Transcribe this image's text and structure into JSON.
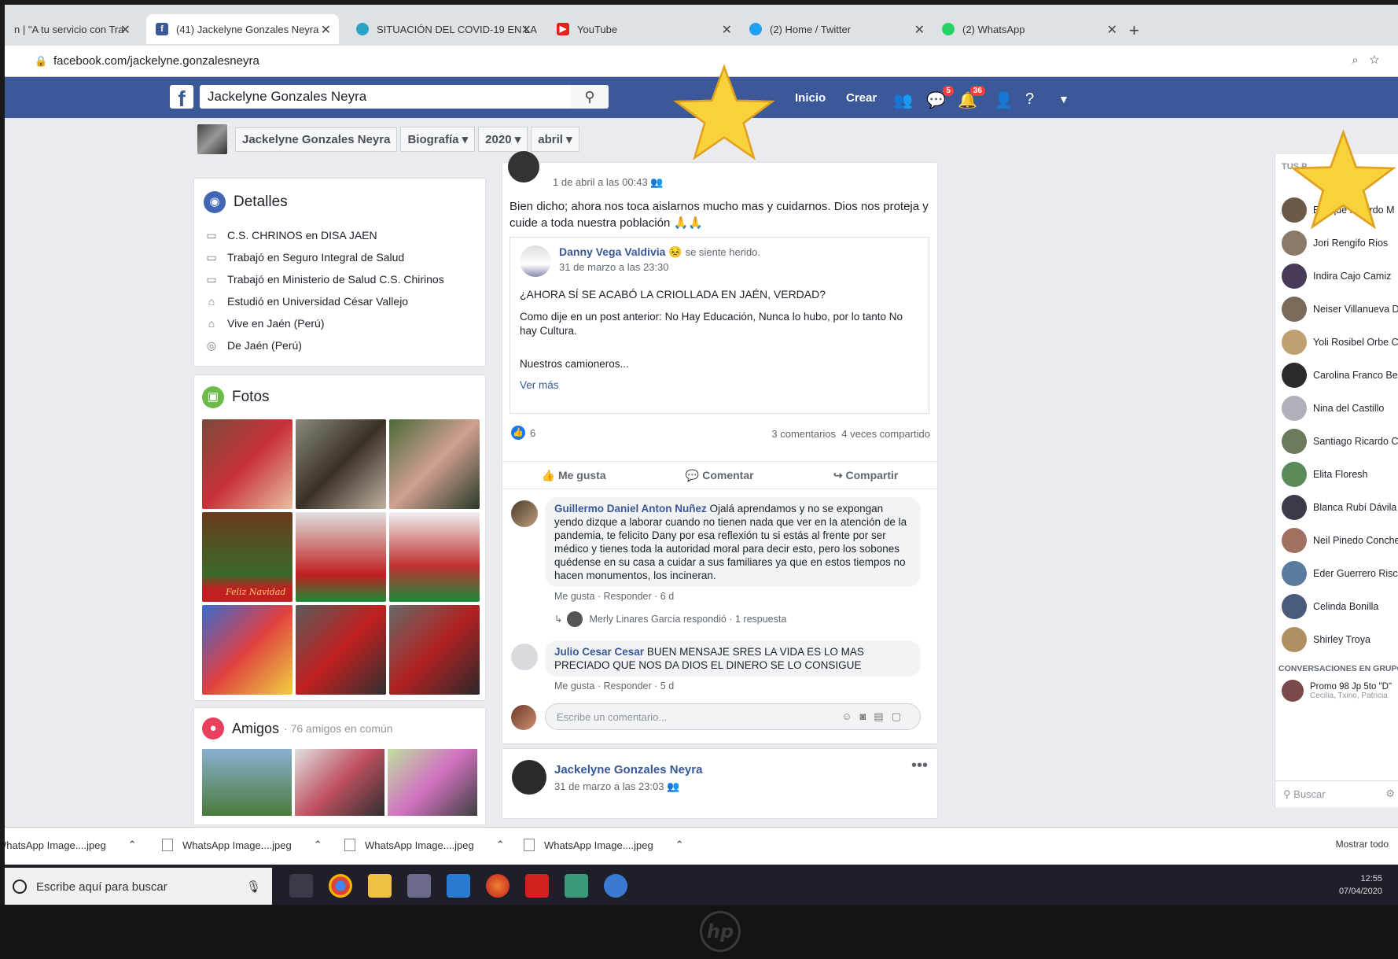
{
  "tabs": [
    {
      "title": "n | \"A tu servicio con Tra",
      "icon": "tab-doc-icon"
    },
    {
      "title": "(41) Jackelyne Gonzales Neyra",
      "icon": "facebook-icon"
    },
    {
      "title": "SITUACIÓN DEL COVID-19 EN LA",
      "icon": "globe-icon"
    },
    {
      "title": "YouTube",
      "icon": "youtube-icon"
    },
    {
      "title": "(2) Home / Twitter",
      "icon": "twitter-icon"
    },
    {
      "title": "(2) WhatsApp",
      "icon": "whatsapp-icon"
    }
  ],
  "url": "facebook.com/jackelyne.gonzalesneyra",
  "fb": {
    "search_value": "Jackelyne Gonzales Neyra",
    "nav": {
      "home": "Inicio",
      "create": "Crear",
      "messages_badge": "5",
      "notifications_badge": "36"
    }
  },
  "subnav": {
    "name": "Jackelyne Gonzales Neyra",
    "biography": "Biografía",
    "year": "2020",
    "month": "abril"
  },
  "details": {
    "title": "Detalles",
    "items": [
      "C.S. CHRINOS en DISA JAEN",
      "Trabajó en Seguro Integral de Salud",
      "Trabajó en Ministerio de Salud C.S. Chirinos",
      "Estudió en Universidad César Vallejo",
      "Vive en Jaén (Perú)",
      "De Jaén (Perú)"
    ]
  },
  "photos": {
    "title": "Fotos",
    "caption": "Feliz Navidad"
  },
  "friends": {
    "title": "Amigos",
    "subtitle": "· 76 amigos en común"
  },
  "post": {
    "timestamp": "1 de abril a las 00:43",
    "text": "Bien dicho; ahora nos toca aislarnos mucho mas y cuidarnos. Dios nos proteja y cuide a toda nuestra población 🙏🙏",
    "shared": {
      "author": "Danny Vega Valdivia",
      "feeling": "se siente herido.",
      "timestamp": "31 de marzo a las 23:30",
      "headline": "¿AHORA SÍ SE ACABÓ LA CRIOLLADA EN JAÉN, VERDAD?",
      "body": "Como dije en un post anterior: No Hay Educación, Nunca lo hubo, por lo tanto No hay Cultura.",
      "body2": "Nuestros camioneros...",
      "more": "Ver más"
    },
    "likes": "6",
    "comments_count": "3 comentarios",
    "shares_count": "4 veces compartido",
    "actions": {
      "like": "Me gusta",
      "comment": "Comentar",
      "share": "Compartir"
    }
  },
  "comments": [
    {
      "name": "Guillermo Daniel Anton Nuñez",
      "text": "Ojalá aprendamos y no se expongan yendo dizque a laborar cuando no tienen nada que ver en la atención de la pandemia, te felicito Dany por esa reflexión tu si estás al frente por ser médico y tienes toda la autoridad moral para decir esto, pero los sobones quédense en su casa a cuidar a sus familiares ya que en estos tiempos no hacen monumentos, los incineran.",
      "actions": "Me gusta · Responder · 6 d",
      "reply": "Merly Linares García respondió · 1 respuesta"
    },
    {
      "name": "Julio Cesar Cesar",
      "text": "BUEN MENSAJE SRES LA VIDA ES LO MAS PRECIADO QUE NOS DA DIOS EL DINERO SE LO CONSIGUE",
      "actions": "Me gusta · Responder · 5 d"
    }
  ],
  "comment_input": {
    "placeholder": "Escribe un comentario..."
  },
  "next_post": {
    "author": "Jackelyne Gonzales Neyra",
    "timestamp": "31 de marzo a las 23:03"
  },
  "chat": {
    "header": "TUS P",
    "contacts": [
      "Enrique Ricardo M",
      "Jori Rengifo Rios",
      "Indira Cajo Camiz",
      "Neiser Villanueva D",
      "Yoli Rosibel Orbe C",
      "Carolina Franco Be",
      "Nina del Castillo",
      "Santiago Ricardo Ca",
      "Elita Floresh",
      "Blanca Rubí Dávila",
      "Neil Pinedo Conche",
      "Eder Guerrero Risco",
      "Celinda Bonilla",
      "Shirley Troya"
    ],
    "group_header": "CONVERSACIONES EN GRUPO",
    "group_name": "Promo 98 Jp 5to \"D\"",
    "group_members": "Cecilia, Txino, Patricia",
    "search_placeholder": "Buscar"
  },
  "downloads": {
    "items": [
      "WhatsApp Image....jpeg",
      "WhatsApp Image....jpeg",
      "WhatsApp Image....jpeg",
      "WhatsApp Image....jpeg"
    ],
    "show_all": "Mostrar todo"
  },
  "taskbar": {
    "search": "Escribe aquí para buscar",
    "time": "12:55",
    "date": "07/04/2020"
  },
  "colors": {
    "fb_blue": "#3b5998",
    "link": "#385898",
    "star": "#f7d23a"
  }
}
